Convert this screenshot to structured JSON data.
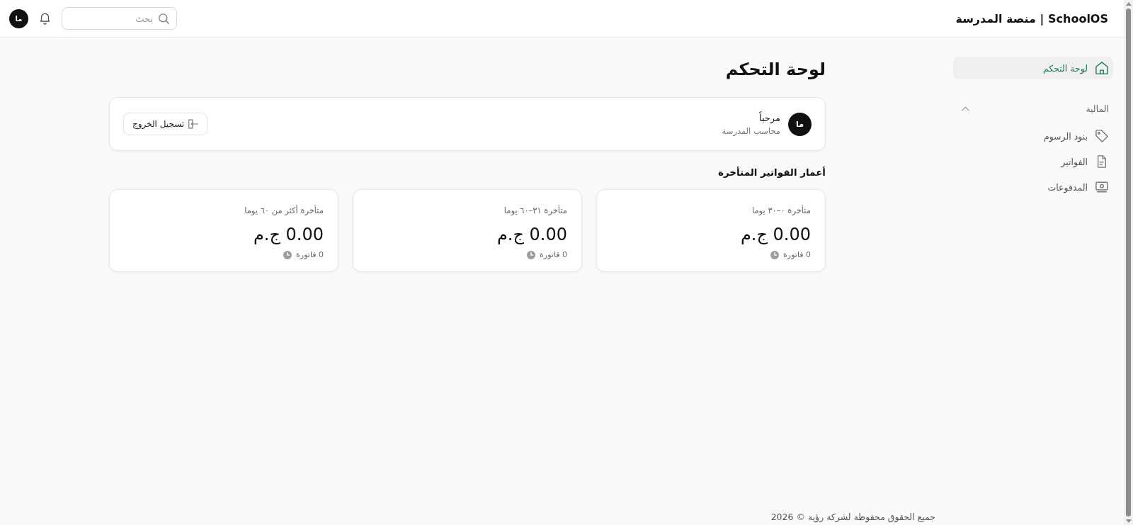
{
  "topbar": {
    "brand": "SchoolOS | منصة المدرسة",
    "search": {
      "placeholder": "بحث"
    },
    "avatar": "ما"
  },
  "sidebar": {
    "items": [
      {
        "kind": "link",
        "label": "لوحة التحكم",
        "selected": true
      },
      {
        "kind": "group",
        "label": "المالية",
        "expanded": true,
        "children": [
          {
            "label": "بنود الرسوم",
            "selected": false
          },
          {
            "label": "الفواتير",
            "selected": false
          },
          {
            "label": "المدفوعات",
            "selected": false
          }
        ]
      }
    ]
  },
  "page": {
    "title": "لوحة التحكم"
  },
  "welcome": {
    "avatar": "ما",
    "greeting": "مرحباً",
    "role": "محاسب المدرسة",
    "logout": "تسجيل الخروج"
  },
  "aging": {
    "title": "أعمار الفواتير المتأخرة",
    "cards": [
      {
        "label": "متأخرة ٠–٣٠ يوما",
        "amount": "0.00 ج.م",
        "count": "0 فاتورة"
      },
      {
        "label": "متأخرة ٣١–٦٠ يوما",
        "amount": "0.00 ج.م",
        "count": "0 فاتورة"
      },
      {
        "label": "متأخرة أكثر من ٦٠ يوما",
        "amount": "0.00 ج.م",
        "count": "0 فاتورة"
      }
    ]
  },
  "footer": {
    "text": "جميع الحقوق محفوظة لشركة رؤية © 2026"
  }
}
